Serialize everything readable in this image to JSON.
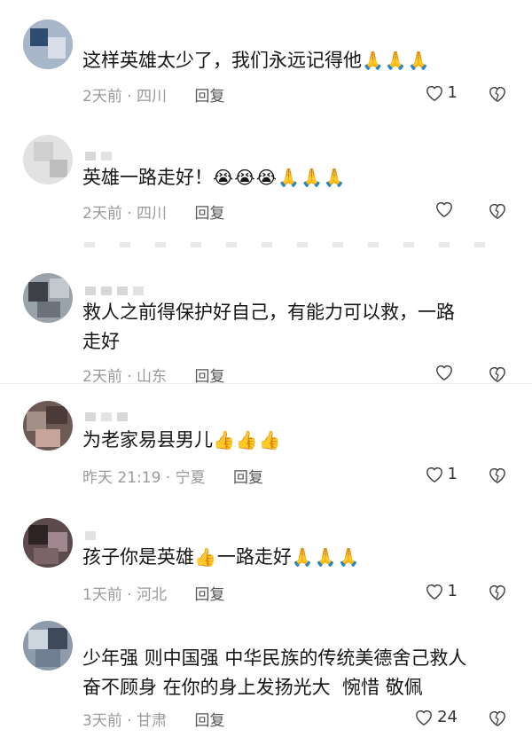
{
  "comments": [
    {
      "text": "这样英雄太少了，我们永远记得他",
      "emoji": "🙏🙏🙏",
      "time": "2天前",
      "location": "四川",
      "reply": "回复",
      "likes": "1"
    },
    {
      "text": "英雄一路走好！",
      "emoji": "😭😭😭🙏🙏🙏",
      "time": "2天前",
      "location": "四川",
      "reply": "回复",
      "likes": ""
    },
    {
      "text": "救人之前得保护好自己，有能力可以救，一路\n走好",
      "emoji": "",
      "time": "2天前",
      "location": "山东",
      "reply": "回复",
      "likes": ""
    },
    {
      "text": "为老家易县男儿",
      "emoji": "👍👍👍",
      "time": "昨天 21:19",
      "location": "宁夏",
      "reply": "回复",
      "likes": "1"
    },
    {
      "text": "孩子你是英雄",
      "emoji": "👍",
      "text2": "一路走好",
      "emoji2": "🙏🙏🙏",
      "time": "1天前",
      "location": "河北",
      "reply": "回复",
      "likes": "1"
    },
    {
      "text": "少年强 则中国强 中华民族的传统美德舍己救人\n奋不顾身 在你的身上发扬光大  惋惜 敬佩",
      "emoji": "",
      "time": "3天前",
      "location": "甘肃",
      "reply": "回复",
      "likes": "24"
    }
  ],
  "meta_separator": " · ",
  "colors": {
    "meta": "#9a9a9a",
    "reply": "#545454",
    "text": "#161616"
  }
}
